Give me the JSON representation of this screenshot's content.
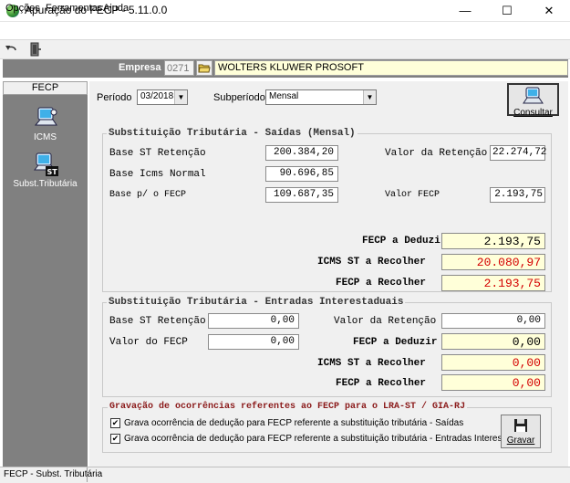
{
  "window": {
    "title": "Apuração do FECP - 5.11.0.0",
    "minimize": "—",
    "maximize": "☐",
    "close": "✕"
  },
  "menu": {
    "opcoes": "Opções",
    "ferramentas": "Ferramentas",
    "ajuda": "Ajuda"
  },
  "toolbar": {
    "icons": [
      "undo-arrow-icon",
      "exit-door-icon"
    ]
  },
  "empresa": {
    "label": "Empresa",
    "code": "0271",
    "name": "WOLTERS KLUWER PROSOFT"
  },
  "sidebar": {
    "header": "FECP",
    "items": [
      {
        "label": "ICMS",
        "icon": "monitor-icon"
      },
      {
        "label": "Subst.Tributária",
        "icon": "monitor-st-icon"
      }
    ]
  },
  "filters": {
    "periodo_label": "Período",
    "periodo_value": "03/2018",
    "subperiodo_label": "Subperíodo",
    "subperiodo_value": "Mensal",
    "consultar": "Consultar"
  },
  "saidas": {
    "title": "Substituição Tributária - Saídas (Mensal)",
    "base_st_label": "Base ST Retenção",
    "base_st_value": "200.384,20",
    "valor_retencao_label": "Valor da Retenção",
    "valor_retencao_value": "22.274,72",
    "base_icms_label": "Base Icms Normal",
    "base_icms_value": "90.696,85",
    "base_fecp_label": "Base p/ o FECP",
    "base_fecp_value": "109.687,35",
    "valor_fecp_label": "Valor FECP",
    "valor_fecp_value": "2.193,75",
    "fecp_deduzir_label": "FECP a Deduzir",
    "fecp_deduzir_value": "2.193,75",
    "icms_st_label": "ICMS ST a Recolher",
    "icms_st_value": "20.080,97",
    "fecp_recolher_label": "FECP a Recolher",
    "fecp_recolher_value": "2.193,75"
  },
  "entradas": {
    "title": "Substituição Tributária - Entradas Interestaduais",
    "base_st_label": "Base ST Retenção",
    "base_st_value": "0,00",
    "valor_retencao_label": "Valor da Retenção",
    "valor_retencao_value": "0,00",
    "valor_fecp_label": "Valor do FECP",
    "valor_fecp_value": "0,00",
    "fecp_deduzir_label": "FECP a Deduzir",
    "fecp_deduzir_value": "0,00",
    "icms_st_label": "ICMS ST a Recolher",
    "icms_st_value": "0,00",
    "fecp_recolher_label": "FECP a Recolher",
    "fecp_recolher_value": "0,00"
  },
  "gravacao": {
    "title": "Gravação de ocorrências referentes ao FECP  para o LRA-ST / GIA-RJ",
    "check1": "Grava ocorrência de dedução para FECP referente a substituição tributária - Saídas",
    "check2": "Grava ocorrência de dedução para FECP referente a substituição tributária - Entradas Interestaduais",
    "gravar": "Gravar"
  },
  "status": {
    "text": "FECP - Subst. Tributária"
  },
  "colors": {
    "sidebar": "#808080",
    "highlight_field": "#ffffd9",
    "negative_red": "#d40000"
  }
}
